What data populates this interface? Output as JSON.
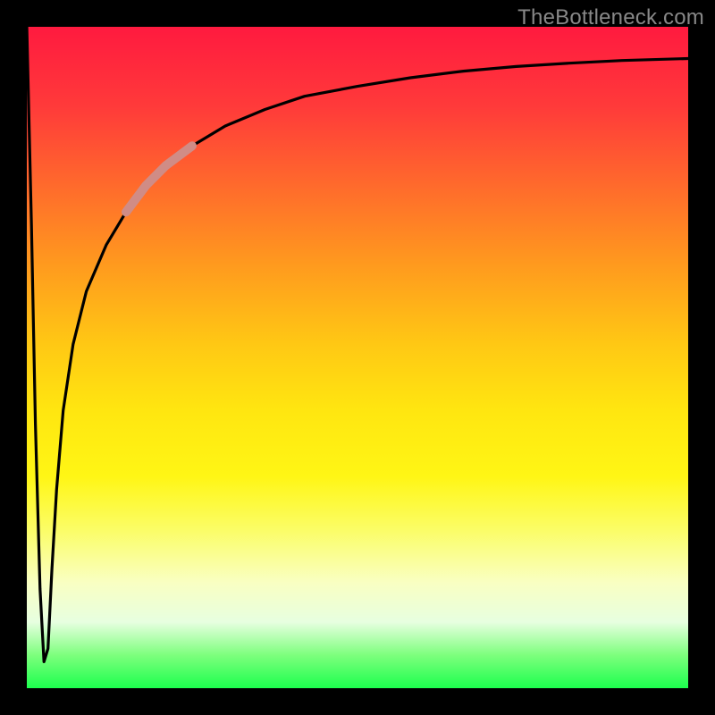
{
  "attribution": "TheBottleneck.com",
  "chart_data": {
    "type": "line",
    "title": "",
    "xlabel": "",
    "ylabel": "",
    "xlim": [
      0,
      100
    ],
    "ylim": [
      0,
      100
    ],
    "background_gradient": {
      "orientation": "vertical",
      "stops": [
        {
          "pos": 0,
          "color": "#ff1a3f"
        },
        {
          "pos": 24,
          "color": "#ff6a2c"
        },
        {
          "pos": 48,
          "color": "#ffc814"
        },
        {
          "pos": 68,
          "color": "#fff615"
        },
        {
          "pos": 84,
          "color": "#f9ffc2"
        },
        {
          "pos": 95,
          "color": "#7dff7d"
        },
        {
          "pos": 100,
          "color": "#1cff4e"
        }
      ]
    },
    "series": [
      {
        "name": "bottleneck-curve",
        "color": "#000000",
        "x": [
          0,
          0.7,
          1.3,
          2.0,
          2.6,
          3.2,
          3.8,
          4.5,
          5.5,
          7,
          9,
          12,
          15,
          18,
          21,
          25,
          30,
          36,
          42,
          50,
          58,
          66,
          74,
          82,
          90,
          100
        ],
        "y": [
          100,
          70,
          40,
          15,
          4,
          6,
          18,
          30,
          42,
          52,
          60,
          67,
          72,
          76,
          79,
          82,
          85,
          87.5,
          89.5,
          91,
          92.3,
          93.3,
          94,
          94.5,
          94.9,
          95.2
        ]
      },
      {
        "name": "highlight-segment",
        "color": "#d08c86",
        "x": [
          15,
          18,
          21,
          25
        ],
        "y": [
          72,
          76,
          79,
          82
        ]
      }
    ]
  }
}
